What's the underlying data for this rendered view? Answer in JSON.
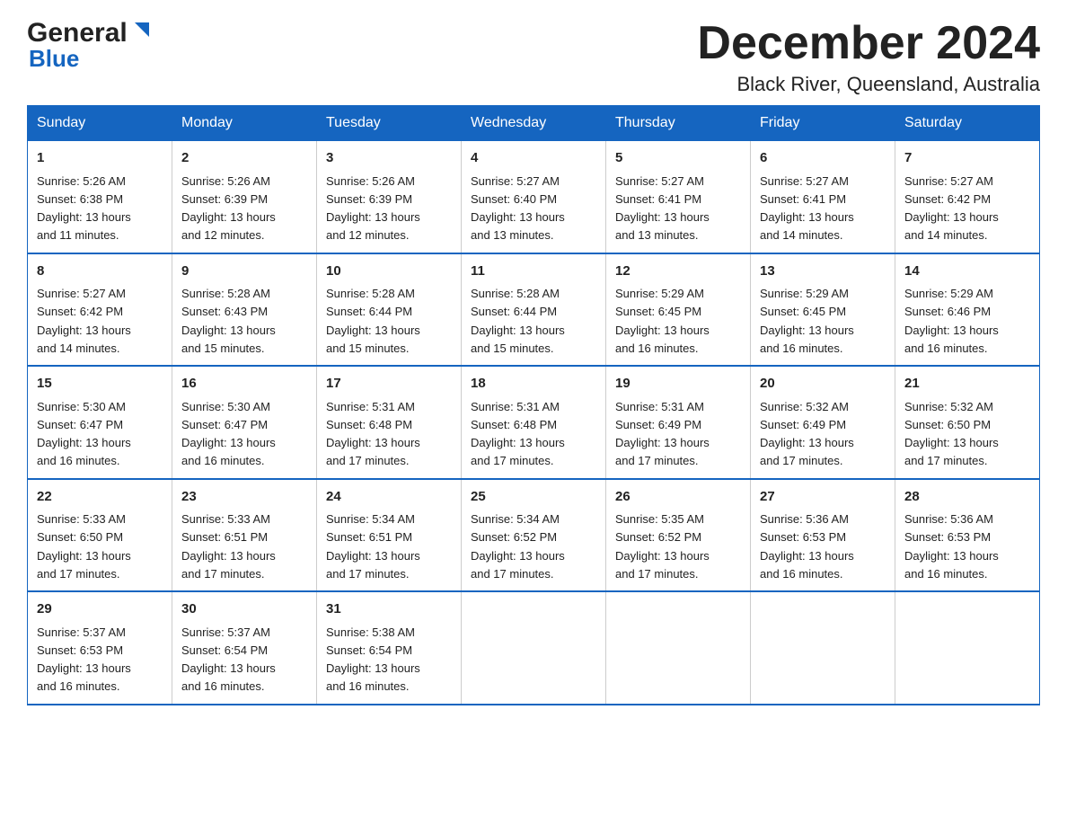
{
  "header": {
    "logo_general": "General",
    "logo_blue": "Blue",
    "title": "December 2024",
    "subtitle": "Black River, Queensland, Australia"
  },
  "days_of_week": [
    "Sunday",
    "Monday",
    "Tuesday",
    "Wednesday",
    "Thursday",
    "Friday",
    "Saturday"
  ],
  "weeks": [
    [
      {
        "day": "1",
        "sunrise": "5:26 AM",
        "sunset": "6:38 PM",
        "daylight": "13 hours and 11 minutes."
      },
      {
        "day": "2",
        "sunrise": "5:26 AM",
        "sunset": "6:39 PM",
        "daylight": "13 hours and 12 minutes."
      },
      {
        "day": "3",
        "sunrise": "5:26 AM",
        "sunset": "6:39 PM",
        "daylight": "13 hours and 12 minutes."
      },
      {
        "day": "4",
        "sunrise": "5:27 AM",
        "sunset": "6:40 PM",
        "daylight": "13 hours and 13 minutes."
      },
      {
        "day": "5",
        "sunrise": "5:27 AM",
        "sunset": "6:41 PM",
        "daylight": "13 hours and 13 minutes."
      },
      {
        "day": "6",
        "sunrise": "5:27 AM",
        "sunset": "6:41 PM",
        "daylight": "13 hours and 14 minutes."
      },
      {
        "day": "7",
        "sunrise": "5:27 AM",
        "sunset": "6:42 PM",
        "daylight": "13 hours and 14 minutes."
      }
    ],
    [
      {
        "day": "8",
        "sunrise": "5:27 AM",
        "sunset": "6:42 PM",
        "daylight": "13 hours and 14 minutes."
      },
      {
        "day": "9",
        "sunrise": "5:28 AM",
        "sunset": "6:43 PM",
        "daylight": "13 hours and 15 minutes."
      },
      {
        "day": "10",
        "sunrise": "5:28 AM",
        "sunset": "6:44 PM",
        "daylight": "13 hours and 15 minutes."
      },
      {
        "day": "11",
        "sunrise": "5:28 AM",
        "sunset": "6:44 PM",
        "daylight": "13 hours and 15 minutes."
      },
      {
        "day": "12",
        "sunrise": "5:29 AM",
        "sunset": "6:45 PM",
        "daylight": "13 hours and 16 minutes."
      },
      {
        "day": "13",
        "sunrise": "5:29 AM",
        "sunset": "6:45 PM",
        "daylight": "13 hours and 16 minutes."
      },
      {
        "day": "14",
        "sunrise": "5:29 AM",
        "sunset": "6:46 PM",
        "daylight": "13 hours and 16 minutes."
      }
    ],
    [
      {
        "day": "15",
        "sunrise": "5:30 AM",
        "sunset": "6:47 PM",
        "daylight": "13 hours and 16 minutes."
      },
      {
        "day": "16",
        "sunrise": "5:30 AM",
        "sunset": "6:47 PM",
        "daylight": "13 hours and 16 minutes."
      },
      {
        "day": "17",
        "sunrise": "5:31 AM",
        "sunset": "6:48 PM",
        "daylight": "13 hours and 17 minutes."
      },
      {
        "day": "18",
        "sunrise": "5:31 AM",
        "sunset": "6:48 PM",
        "daylight": "13 hours and 17 minutes."
      },
      {
        "day": "19",
        "sunrise": "5:31 AM",
        "sunset": "6:49 PM",
        "daylight": "13 hours and 17 minutes."
      },
      {
        "day": "20",
        "sunrise": "5:32 AM",
        "sunset": "6:49 PM",
        "daylight": "13 hours and 17 minutes."
      },
      {
        "day": "21",
        "sunrise": "5:32 AM",
        "sunset": "6:50 PM",
        "daylight": "13 hours and 17 minutes."
      }
    ],
    [
      {
        "day": "22",
        "sunrise": "5:33 AM",
        "sunset": "6:50 PM",
        "daylight": "13 hours and 17 minutes."
      },
      {
        "day": "23",
        "sunrise": "5:33 AM",
        "sunset": "6:51 PM",
        "daylight": "13 hours and 17 minutes."
      },
      {
        "day": "24",
        "sunrise": "5:34 AM",
        "sunset": "6:51 PM",
        "daylight": "13 hours and 17 minutes."
      },
      {
        "day": "25",
        "sunrise": "5:34 AM",
        "sunset": "6:52 PM",
        "daylight": "13 hours and 17 minutes."
      },
      {
        "day": "26",
        "sunrise": "5:35 AM",
        "sunset": "6:52 PM",
        "daylight": "13 hours and 17 minutes."
      },
      {
        "day": "27",
        "sunrise": "5:36 AM",
        "sunset": "6:53 PM",
        "daylight": "13 hours and 16 minutes."
      },
      {
        "day": "28",
        "sunrise": "5:36 AM",
        "sunset": "6:53 PM",
        "daylight": "13 hours and 16 minutes."
      }
    ],
    [
      {
        "day": "29",
        "sunrise": "5:37 AM",
        "sunset": "6:53 PM",
        "daylight": "13 hours and 16 minutes."
      },
      {
        "day": "30",
        "sunrise": "5:37 AM",
        "sunset": "6:54 PM",
        "daylight": "13 hours and 16 minutes."
      },
      {
        "day": "31",
        "sunrise": "5:38 AM",
        "sunset": "6:54 PM",
        "daylight": "13 hours and 16 minutes."
      },
      null,
      null,
      null,
      null
    ]
  ],
  "labels": {
    "sunrise": "Sunrise:",
    "sunset": "Sunset:",
    "daylight": "Daylight:"
  }
}
